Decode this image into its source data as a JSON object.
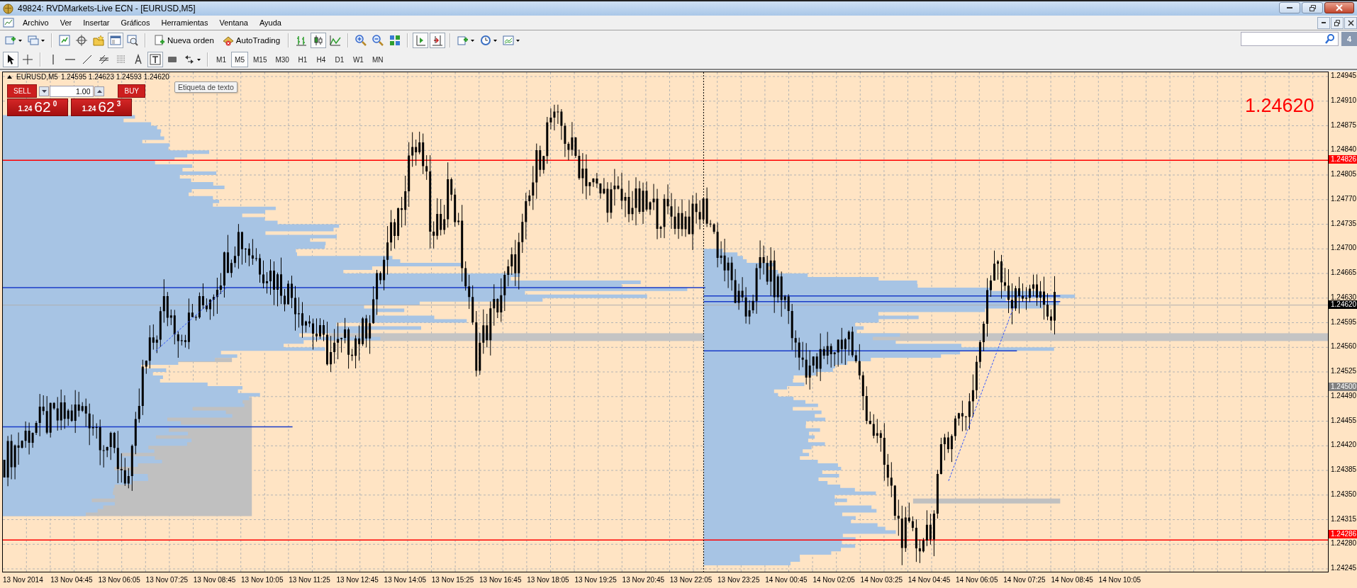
{
  "window": {
    "title": "49824: RVDMarkets-Live ECN - [EURUSD,M5]"
  },
  "menu": [
    "Archivo",
    "Ver",
    "Insertar",
    "Gráficos",
    "Herramientas",
    "Ventana",
    "Ayuda"
  ],
  "toolbar_main": [
    {
      "kind": "dropdown",
      "selected": false
    },
    {
      "kind": "dropdown",
      "selected": false
    },
    {
      "kind": "separator"
    },
    {
      "kind": "icon",
      "selected": false
    },
    {
      "kind": "icon",
      "selected": false
    },
    {
      "kind": "icon",
      "selected": false
    },
    {
      "kind": "icon",
      "selected": true
    },
    {
      "kind": "icon",
      "selected": false
    },
    {
      "kind": "separator"
    },
    {
      "kind": "labeled",
      "label": "Nueva orden",
      "selected": false
    },
    {
      "kind": "labeled",
      "label": "AutoTrading",
      "selected": false
    },
    {
      "kind": "separator"
    },
    {
      "kind": "icon",
      "selected": false
    },
    {
      "kind": "icon",
      "selected": true
    },
    {
      "kind": "icon",
      "selected": false
    },
    {
      "kind": "separator"
    },
    {
      "kind": "icon",
      "selected": false
    },
    {
      "kind": "icon",
      "selected": false
    },
    {
      "kind": "icon",
      "selected": false
    },
    {
      "kind": "separator"
    },
    {
      "kind": "icon",
      "selected": true
    },
    {
      "kind": "icon",
      "selected": true
    },
    {
      "kind": "separator"
    },
    {
      "kind": "dropdown",
      "selected": false
    },
    {
      "kind": "dropdown",
      "selected": false
    },
    {
      "kind": "dropdown",
      "selected": false
    }
  ],
  "toolbar_tools": [
    {
      "kind": "icon",
      "selected": true
    },
    {
      "kind": "icon",
      "selected": false
    },
    {
      "kind": "separator"
    },
    {
      "kind": "icon",
      "selected": false
    },
    {
      "kind": "icon",
      "selected": false
    },
    {
      "kind": "icon",
      "selected": false
    },
    {
      "kind": "icon",
      "selected": false
    },
    {
      "kind": "icon",
      "selected": false
    },
    {
      "kind": "icon",
      "selected": false
    },
    {
      "kind": "icon",
      "selected": true
    },
    {
      "kind": "icon",
      "selected": false
    },
    {
      "kind": "dropdown",
      "selected": false
    },
    {
      "kind": "separator"
    },
    {
      "kind": "period",
      "label": "M1",
      "selected": false
    },
    {
      "kind": "period",
      "label": "M5",
      "selected": true
    },
    {
      "kind": "period",
      "label": "M15",
      "selected": false
    },
    {
      "kind": "period",
      "label": "M30",
      "selected": false
    },
    {
      "kind": "period",
      "label": "H1",
      "selected": false
    },
    {
      "kind": "period",
      "label": "H4",
      "selected": false
    },
    {
      "kind": "period",
      "label": "D1",
      "selected": false
    },
    {
      "kind": "period",
      "label": "W1",
      "selected": false
    },
    {
      "kind": "period",
      "label": "MN",
      "selected": false
    }
  ],
  "notifications_badge": "4",
  "chart": {
    "symbol": "EURUSD,M5",
    "quote": "1.24595 1.24623 1.24593 1.24620",
    "tooltip": "Etiqueta de texto",
    "last_price_label": "1.24620",
    "one_click": {
      "sell": {
        "label": "SELL",
        "price_prefix": "1.24",
        "price_main": "62",
        "price_sup": "0"
      },
      "buy": {
        "label": "BUY",
        "price_prefix": "1.24",
        "price_main": "62",
        "price_sup": "3"
      },
      "volume": "1.00"
    },
    "price_axis": [
      "1.24945",
      "1.24910",
      "1.24875",
      "1.24840",
      "1.24805",
      "1.24770",
      "1.24735",
      "1.24700",
      "1.24665",
      "1.24630",
      "1.24595",
      "1.24560",
      "1.24525",
      "1.24490",
      "1.24455",
      "1.24420",
      "1.24385",
      "1.24350",
      "1.24315",
      "1.24280",
      "1.24245"
    ],
    "price_markers": [
      {
        "text": "1.24826",
        "color": "#ff0000"
      },
      {
        "text": "1.24620",
        "color": "#000000"
      },
      {
        "text": "1.24500",
        "color": "#808080"
      },
      {
        "text": "1.24286",
        "color": "#ff0000"
      }
    ],
    "time_axis": [
      "13 Nov 2014",
      "13 Nov 04:45",
      "13 Nov 06:05",
      "13 Nov 07:25",
      "13 Nov 08:45",
      "13 Nov 10:05",
      "13 Nov 11:25",
      "13 Nov 12:45",
      "13 Nov 14:05",
      "13 Nov 15:25",
      "13 Nov 16:45",
      "13 Nov 18:05",
      "13 Nov 19:25",
      "13 Nov 20:45",
      "13 Nov 22:05",
      "13 Nov 23:25",
      "14 Nov 00:45",
      "14 Nov 02:05",
      "14 Nov 03:25",
      "14 Nov 04:45",
      "14 Nov 06:05",
      "14 Nov 07:25",
      "14 Nov 08:45",
      "14 Nov 10:05"
    ]
  }
}
